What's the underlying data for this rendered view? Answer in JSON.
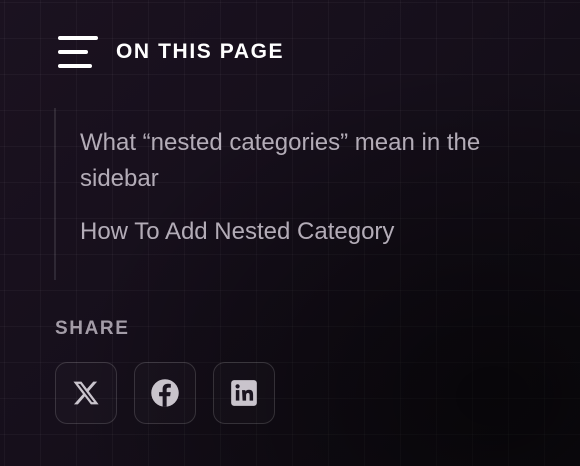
{
  "toc": {
    "title": "ON THIS PAGE",
    "icon": "menu-icon",
    "items": [
      {
        "label": "What “nested categories” mean in the sidebar"
      },
      {
        "label": "How To Add Nested Category"
      }
    ]
  },
  "share": {
    "label": "SHARE",
    "buttons": [
      {
        "icon": "x-twitter-icon",
        "network": "X"
      },
      {
        "icon": "facebook-icon",
        "network": "Facebook"
      },
      {
        "icon": "linkedin-icon",
        "network": "LinkedIn"
      }
    ]
  },
  "colors": {
    "background": "#15101a",
    "title": "#ffffff",
    "link": "#b3acb7",
    "muted": "#a39ca7",
    "icon": "#c9c4cc"
  }
}
